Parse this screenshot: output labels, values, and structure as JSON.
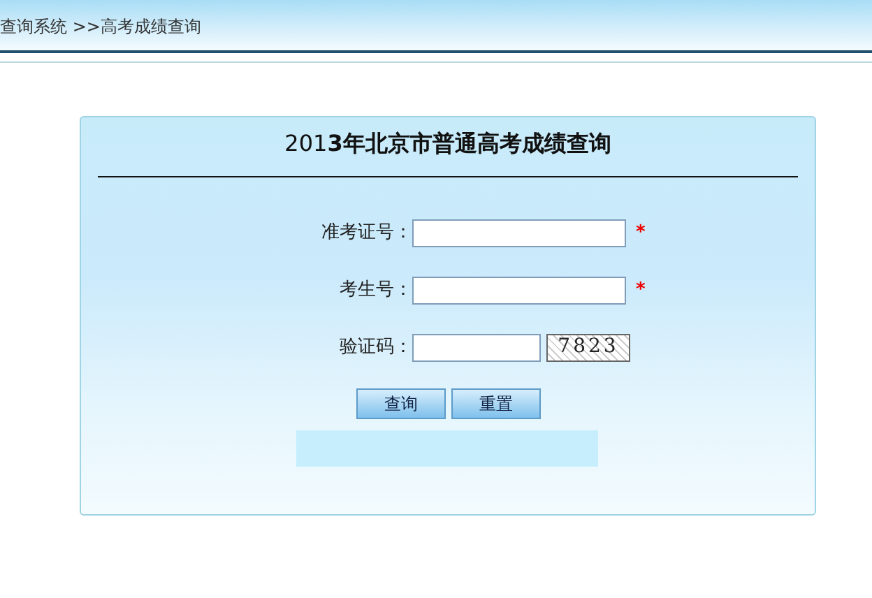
{
  "breadcrumb": "查询系统 >>高考成绩查询",
  "title": "201**3年北京市普通高考成绩查询**",
  "fields": [
    {
      "label": "准考证号：",
      "kind": "text",
      "required": true
    },
    {
      "label": "考生号：",
      "kind": "text",
      "required": true
    },
    {
      "label": "验证码：",
      "kind": "captcha",
      "required": false,
      "captcha": "7823"
    }
  ],
  "required_mark": "*",
  "buttons": [
    "查询",
    "重置"
  ]
}
